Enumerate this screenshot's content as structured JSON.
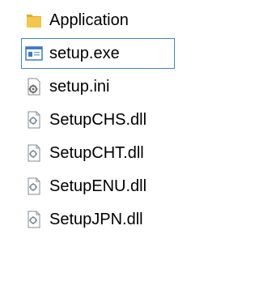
{
  "files": [
    {
      "name": "Application",
      "icon": "folder-icon",
      "selected": false
    },
    {
      "name": "setup.exe",
      "icon": "application-exe-icon",
      "selected": true
    },
    {
      "name": "setup.ini",
      "icon": "config-settings-icon",
      "selected": false
    },
    {
      "name": "SetupCHS.dll",
      "icon": "dll-file-icon",
      "selected": false
    },
    {
      "name": "SetupCHT.dll",
      "icon": "dll-file-icon",
      "selected": false
    },
    {
      "name": "SetupENU.dll",
      "icon": "dll-file-icon",
      "selected": false
    },
    {
      "name": "SetupJPN.dll",
      "icon": "dll-file-icon",
      "selected": false
    }
  ],
  "colors": {
    "selection_border": "#3b86d6",
    "folder_yellow": "#f4c64a",
    "exe_blue": "#3a7cc7"
  }
}
